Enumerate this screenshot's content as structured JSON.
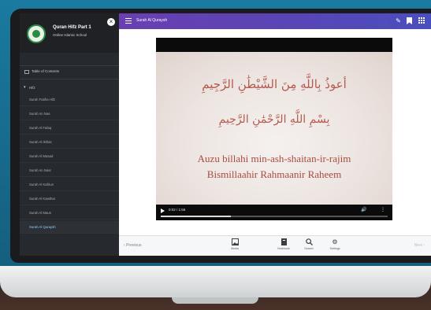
{
  "app": {
    "brand_title": "Quran Hifz Part 1",
    "brand_subtitle": "Online Islamic School"
  },
  "sidebar": {
    "toc_label": "Table of Contents",
    "group_label": "Hifz",
    "items": [
      {
        "label": "Surah Fatiha Hifz"
      },
      {
        "label": "Surah An Nas"
      },
      {
        "label": "Surah Al Falaq"
      },
      {
        "label": "Surah Al Ikhlas"
      },
      {
        "label": "Surah Al Masad"
      },
      {
        "label": "Surah An Nasr"
      },
      {
        "label": "Surah Al Kafirun"
      },
      {
        "label": "Surah Al Kawthar"
      },
      {
        "label": "Surah Al Maun"
      },
      {
        "label": "Surah Al Quraysh"
      }
    ],
    "active_index": 9
  },
  "topbar": {
    "title": "Surah Al Quraysh",
    "color_start": "#6a3fb2",
    "color_end": "#4a4fbf"
  },
  "video": {
    "arabic_line1": "أعوذُ بِاللَّهِ مِنَ الشَّيْطَٰنِ الرَّجِيمِ",
    "arabic_line2": "بِسْمِ اللَّهِ الرَّحْمَٰنِ الرَّحِيمِ",
    "latin_line1": "Auzu billahi min-ash-shaitan-ir-rajim",
    "latin_line2": "Bismillaahir Rahmaanir Raheem",
    "time": "0:02 / 1:56",
    "progress": 0.31
  },
  "bottombar": {
    "prev_label": "Previous",
    "next_label": "Next",
    "tools": [
      {
        "label": "Media",
        "icon": "image-icon"
      },
      {
        "label": "Notebook",
        "icon": "notebook-icon"
      },
      {
        "label": "Search",
        "icon": "search-icon"
      },
      {
        "label": "Settings",
        "icon": "gear-icon"
      }
    ]
  }
}
